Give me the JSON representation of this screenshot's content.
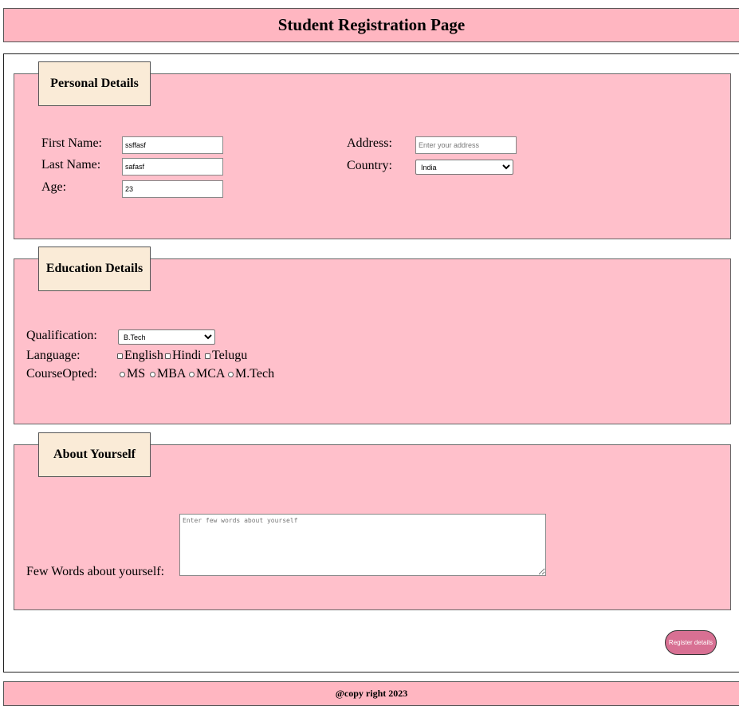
{
  "header": {
    "title": "Student Registration Page"
  },
  "personal": {
    "legend": "Personal Details",
    "first_name_label": "First Name:",
    "first_name_value": "ssffasf",
    "last_name_label": "Last Name:",
    "last_name_value": "safasf",
    "age_label": "Age:",
    "age_value": "23",
    "address_label": "Address:",
    "address_placeholder": "Enter your address",
    "country_label": "Country:",
    "country_value": "India"
  },
  "education": {
    "legend": "Education Details",
    "qualification_label": "Qualification:",
    "qualification_value": "B.Tech",
    "language_label": "Language:",
    "languages": [
      "English",
      "Hindi",
      "Telugu"
    ],
    "course_label": "CourseOpted:",
    "courses": [
      "MS",
      "MBA",
      "MCA",
      "M.Tech"
    ]
  },
  "about": {
    "legend": "About Yourself",
    "label": "Few Words about yourself:",
    "placeholder": "Enter few words about yourself"
  },
  "register_label": "Register details",
  "footer": {
    "text": "@copy right 2023"
  },
  "colors": {
    "header_bg": "#ffb6c1",
    "section_bg": "#ffc0cb",
    "legend_bg": "#faebd7",
    "button_bg": "#d87093"
  }
}
